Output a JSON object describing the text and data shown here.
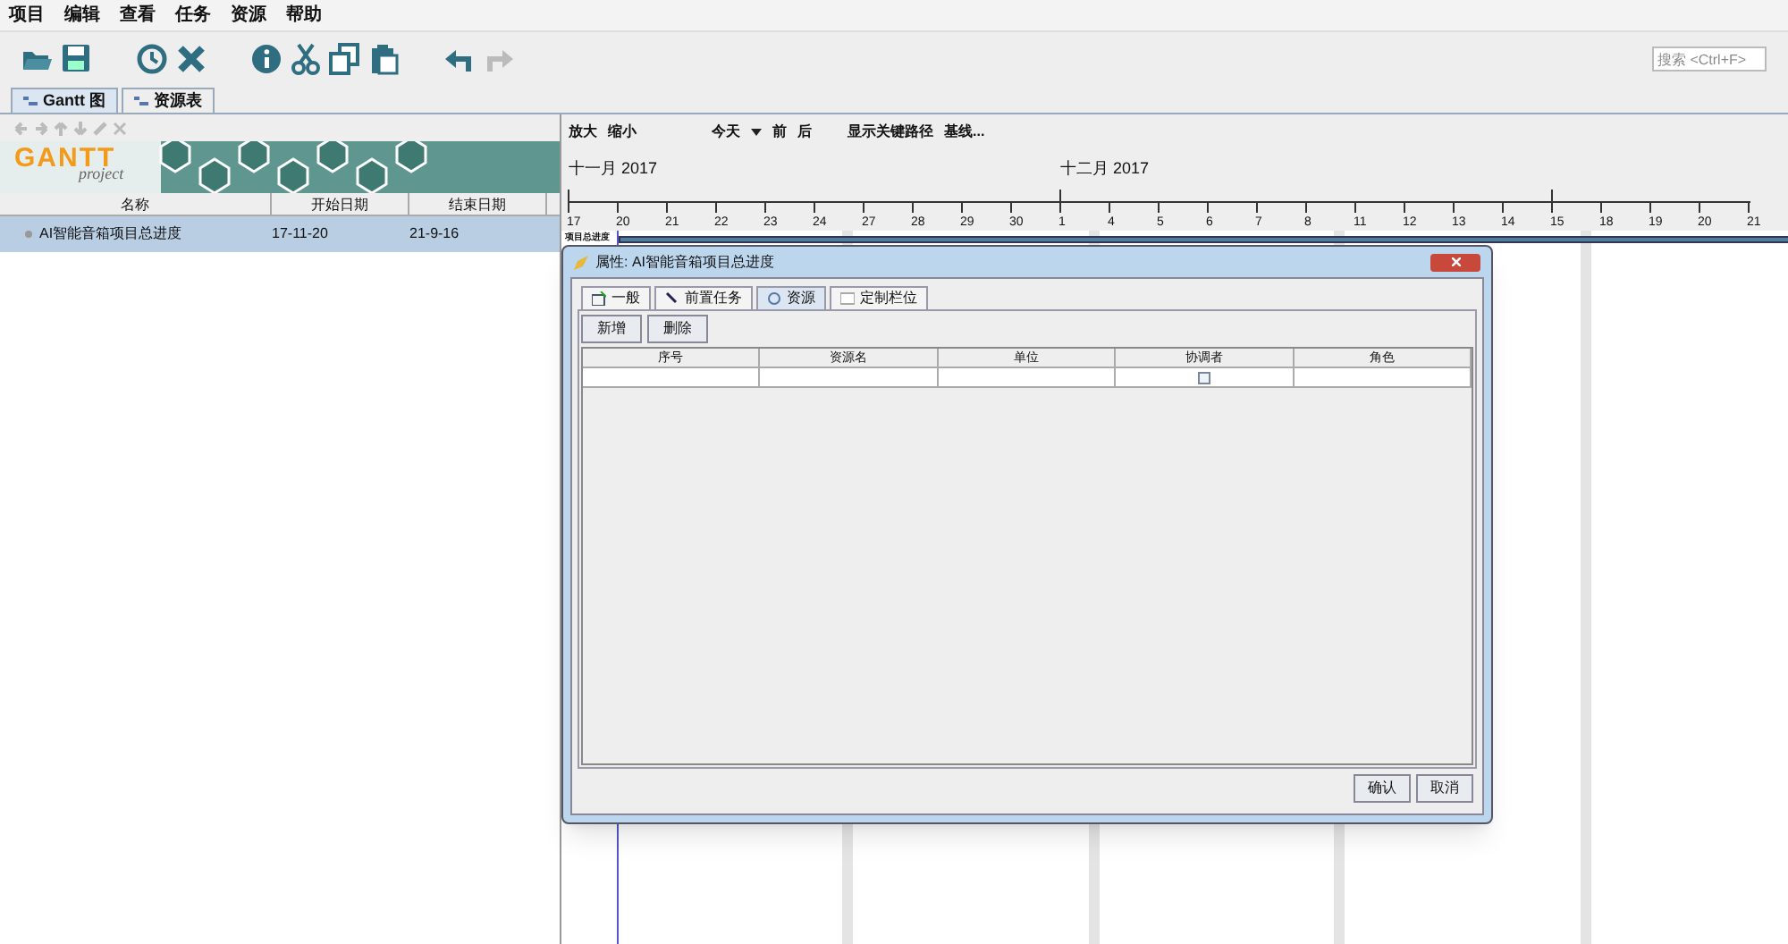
{
  "menu": [
    "项目",
    "编辑",
    "查看",
    "任务",
    "资源",
    "帮助"
  ],
  "search": {
    "placeholder": "搜索 <Ctrl+F>"
  },
  "view_tabs": [
    {
      "label": "Gantt 图",
      "selected": true
    },
    {
      "label": "资源表",
      "selected": false
    }
  ],
  "logo": {
    "word": "GANTT",
    "sub": "project"
  },
  "task_table": {
    "columns": [
      "名称",
      "开始日期",
      "结束日期"
    ],
    "rows": [
      {
        "name": "AI智能音箱项目总进度",
        "start": "17-11-20",
        "end": "21-9-16",
        "selected": true
      }
    ]
  },
  "chart_toolbar": [
    "放大",
    "缩小",
    "今天",
    "前",
    "后",
    "显示关键路径",
    "基线..."
  ],
  "timeline": {
    "months": [
      "十一月 2017",
      "十二月 2017"
    ],
    "days": [
      "17",
      "20",
      "21",
      "22",
      "23",
      "24",
      "27",
      "28",
      "29",
      "30",
      "1",
      "4",
      "5",
      "6",
      "7",
      "8",
      "11",
      "12",
      "13",
      "14",
      "15",
      "18",
      "19",
      "20",
      "21"
    ],
    "bar_label": "项目总进度"
  },
  "dialog": {
    "title": "属性: AI智能音箱项目总进度",
    "tabs": [
      {
        "label": "一般",
        "selected": false
      },
      {
        "label": "前置任务",
        "selected": false
      },
      {
        "label": "资源",
        "selected": true
      },
      {
        "label": "定制栏位",
        "selected": false
      }
    ],
    "actions": [
      "新增",
      "删除"
    ],
    "columns": [
      "序号",
      "资源名",
      "单位",
      "协调者",
      "角色"
    ],
    "row": {
      "coordinator_checked": false
    },
    "buttons": [
      "确认",
      "取消"
    ]
  }
}
